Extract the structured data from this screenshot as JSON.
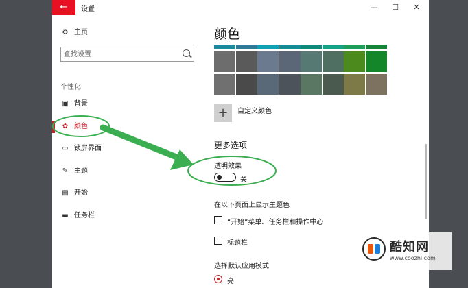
{
  "window": {
    "title": "设置",
    "back_icon": "←",
    "minimize_icon": "—",
    "maximize_icon": "☐",
    "close_icon": "✕"
  },
  "sidebar": {
    "home": {
      "label": "主页",
      "icon": "⚙"
    },
    "search_placeholder": "查找设置",
    "section": "个性化",
    "items": [
      {
        "label": "背景",
        "icon": "▣"
      },
      {
        "label": "颜色",
        "icon": "✿",
        "active": true
      },
      {
        "label": "锁屏界面",
        "icon": "▭"
      },
      {
        "label": "主题",
        "icon": "✎"
      },
      {
        "label": "开始",
        "icon": "▤"
      },
      {
        "label": "任务栏",
        "icon": "▬"
      }
    ]
  },
  "main": {
    "title": "颜色",
    "swatches": [
      [
        "#1b8a9e",
        "#2e7a99",
        "#10a0b6",
        "#168c96",
        "#0f8a7a",
        "#16a085",
        "#1e9e5a",
        "#13863b"
      ],
      [
        "#6d6d6d",
        "#5a5a5a",
        "#6b7a8f",
        "#5b6677",
        "#567a73",
        "#4f6f62",
        "#4c8a1e",
        "#13862a"
      ],
      [
        "#707070",
        "#4a4a4a",
        "#5a6977",
        "#4c535a",
        "#5a7763",
        "#4b5a4e",
        "#7d7a48",
        "#7d7260"
      ]
    ],
    "custom_color": {
      "icon": "+",
      "label": "自定义颜色"
    },
    "more_options": "更多选项",
    "transparency": {
      "label": "透明效果",
      "state": "关"
    },
    "accent_surfaces": {
      "label": "在以下页面上显示主题色",
      "options": [
        "“开始”菜单、任务栏和操作中心",
        "标题栏"
      ]
    },
    "app_mode": {
      "label": "选择默认应用模式",
      "selected": "亮"
    }
  },
  "watermark": {
    "name": "酷知网",
    "url": "www.coozhi.com"
  },
  "colors": {
    "accent": "#c4232b",
    "back_button": "#e81123",
    "annotation": "#3cae52"
  }
}
